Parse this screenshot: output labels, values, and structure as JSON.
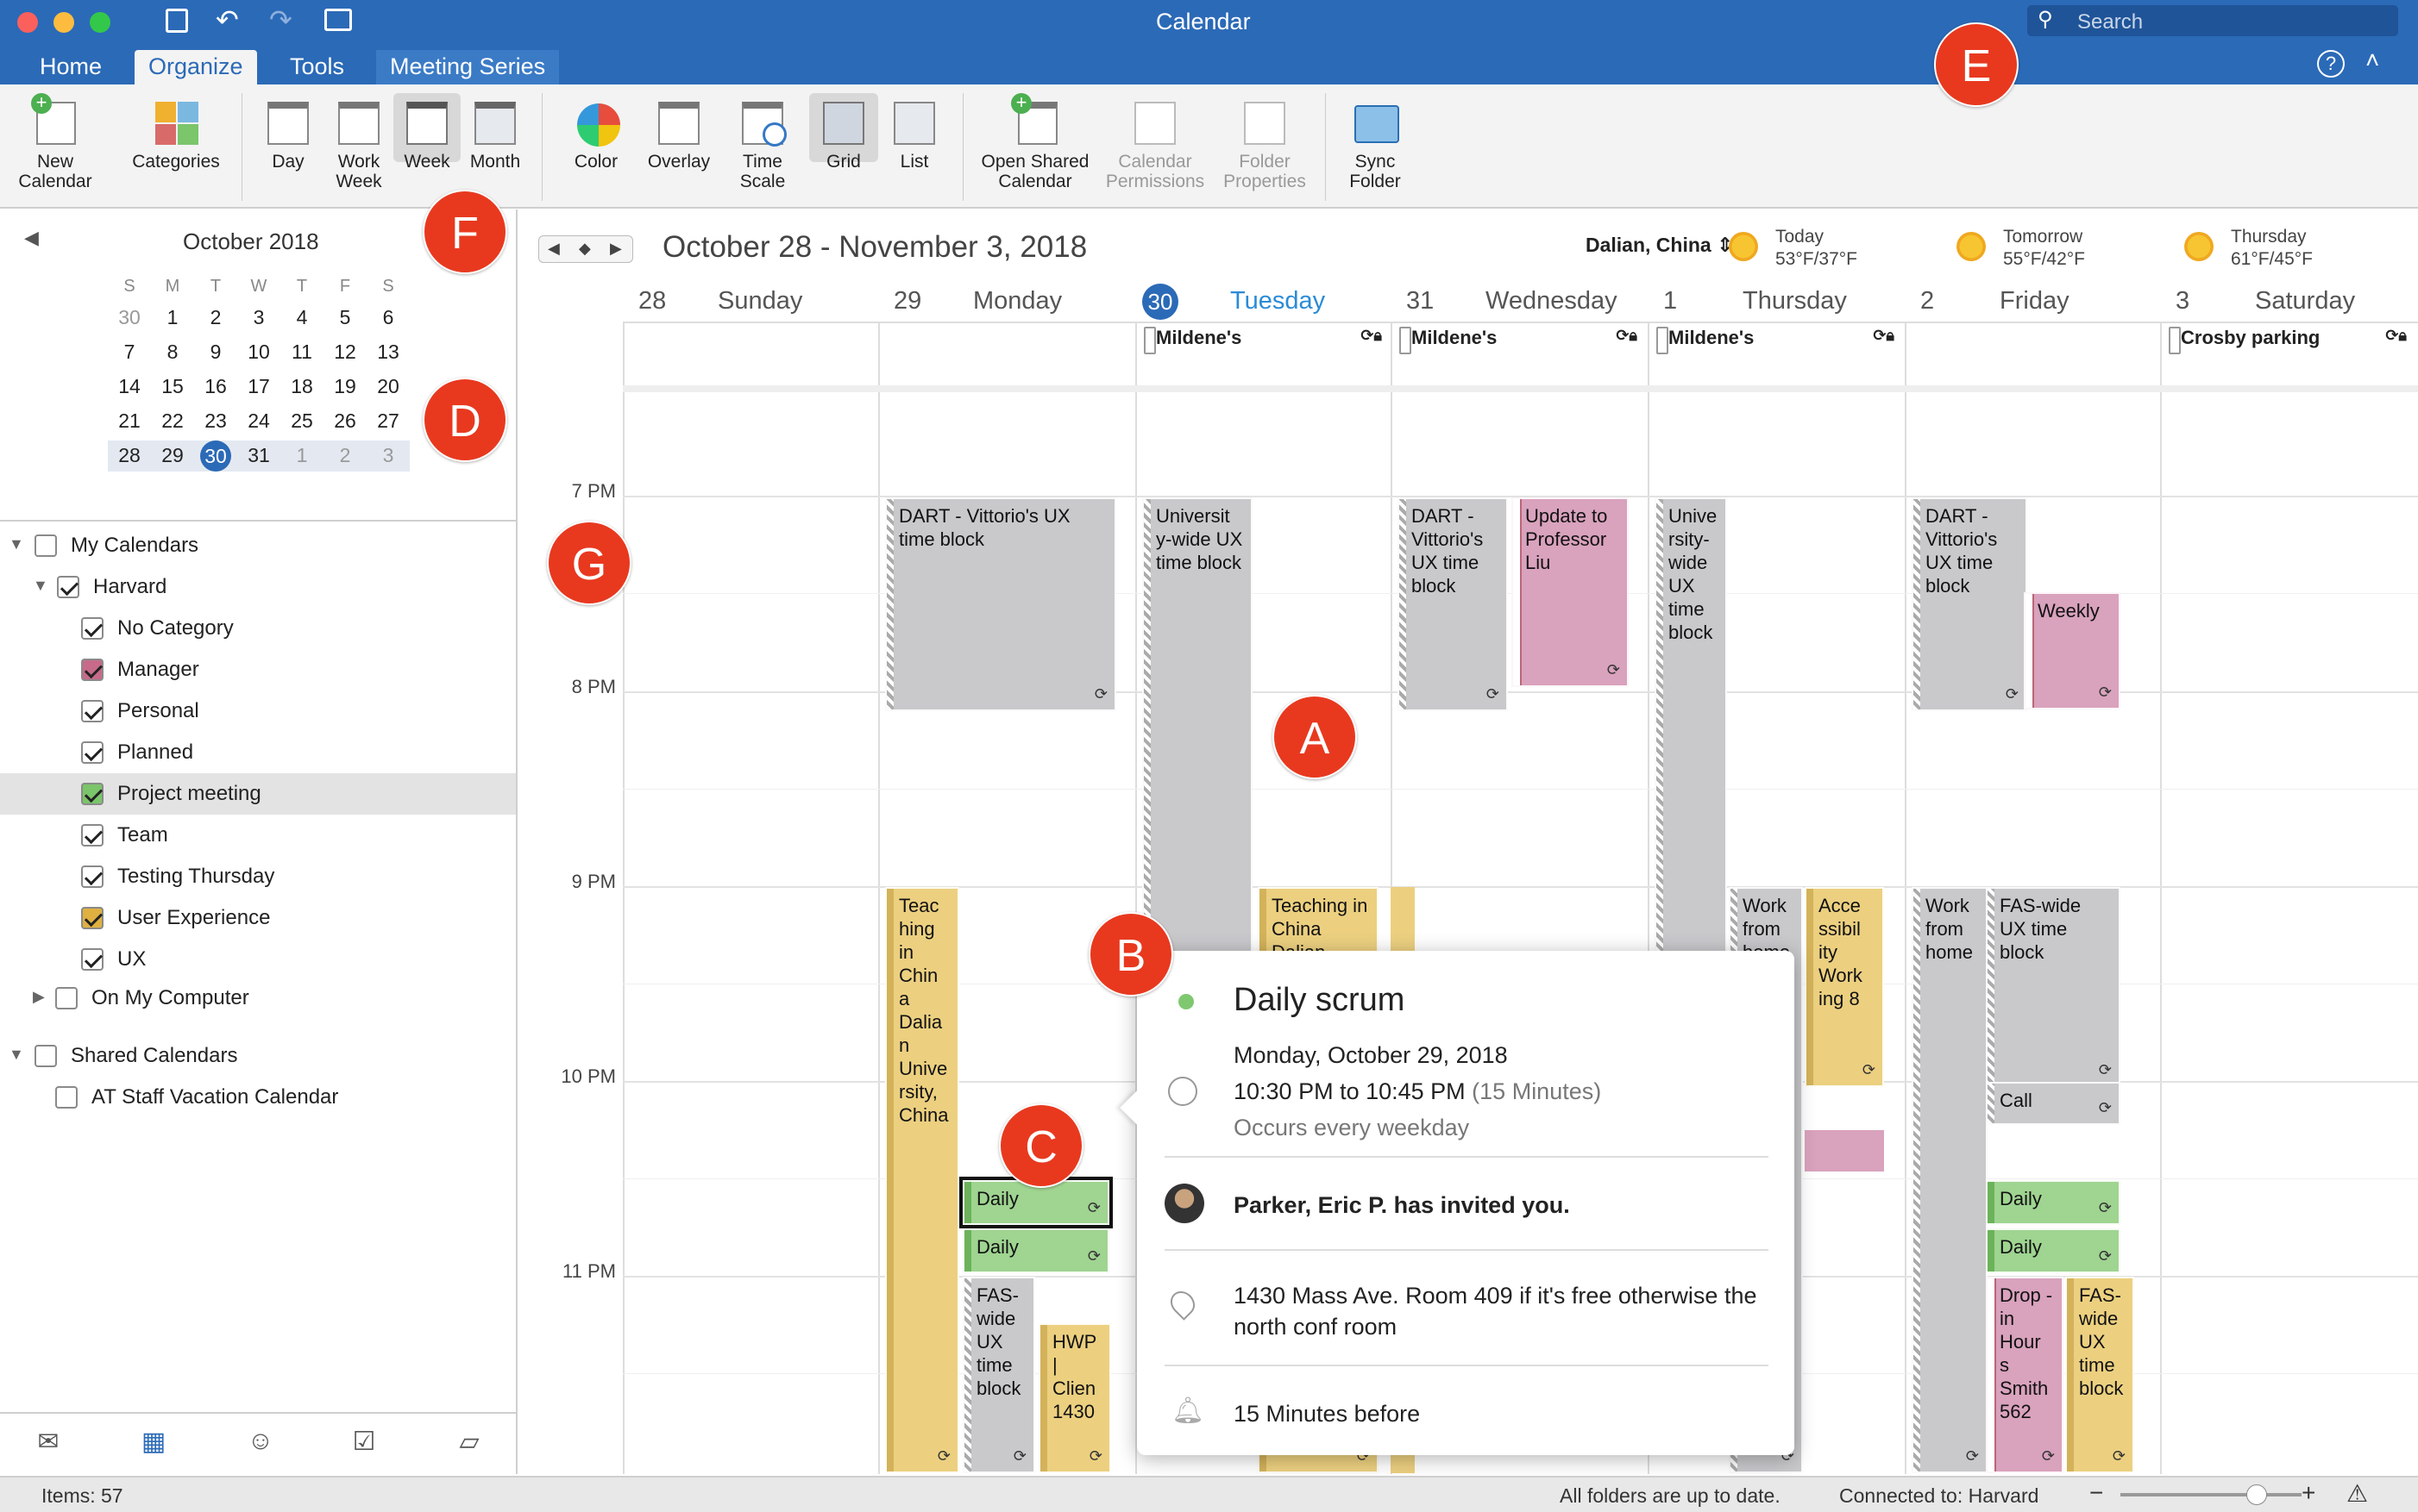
{
  "window": {
    "title": "Calendar",
    "search_placeholder": "Search"
  },
  "tabs": [
    "Home",
    "Organize",
    "Tools",
    "Meeting Series"
  ],
  "ribbon": {
    "new_calendar": "New Calendar",
    "categories": "Categories",
    "day": "Day",
    "work_week": "Work Week",
    "week": "Week",
    "month": "Month",
    "color": "Color",
    "overlay": "Overlay",
    "time_scale": "Time Scale",
    "grid": "Grid",
    "list": "List",
    "open_shared": "Open Shared Calendar",
    "calendar_permissions": "Calendar Permissions",
    "folder_properties": "Folder Properties",
    "sync_folder": "Sync Folder"
  },
  "mini_calendar": {
    "month": "October 2018",
    "weekdays": [
      "S",
      "M",
      "T",
      "W",
      "T",
      "F",
      "S"
    ],
    "weeks": [
      [
        "30",
        "1",
        "2",
        "3",
        "4",
        "5",
        "6"
      ],
      [
        "7",
        "8",
        "9",
        "10",
        "11",
        "12",
        "13"
      ],
      [
        "14",
        "15",
        "16",
        "17",
        "18",
        "19",
        "20"
      ],
      [
        "21",
        "22",
        "23",
        "24",
        "25",
        "26",
        "27"
      ],
      [
        "28",
        "29",
        "30",
        "31",
        "1",
        "2",
        "3"
      ]
    ],
    "today": "30"
  },
  "calendars": {
    "my": "My Calendars",
    "harvard": "Harvard",
    "items": [
      "No Category",
      "Manager",
      "Personal",
      "Planned",
      "Project meeting",
      "Team",
      "Testing Thursday",
      "User Experience",
      "UX"
    ],
    "on_my_computer": "On My Computer",
    "shared": "Shared Calendars",
    "at_staff": "AT Staff Vacation Calendar"
  },
  "main": {
    "range": "October 28 - November 3, 2018",
    "location": "Dalian, China",
    "weather": [
      {
        "label": "Today",
        "temp": "53°F/37°F"
      },
      {
        "label": "Tomorrow",
        "temp": "55°F/42°F"
      },
      {
        "label": "Thursday",
        "temp": "61°F/45°F"
      }
    ],
    "days": [
      {
        "num": "28",
        "name": "Sunday"
      },
      {
        "num": "29",
        "name": "Monday"
      },
      {
        "num": "30",
        "name": "Tuesday"
      },
      {
        "num": "31",
        "name": "Wednesday"
      },
      {
        "num": "1",
        "name": "Thursday"
      },
      {
        "num": "2",
        "name": "Friday"
      },
      {
        "num": "3",
        "name": "Saturday"
      }
    ],
    "allday": [
      "Mildene's",
      "Mildene's",
      "Mildene's",
      "Crosby parking"
    ],
    "times": [
      "7 PM",
      "8 PM",
      "9 PM",
      "10 PM",
      "11 PM"
    ],
    "events": {
      "dart_mon": "DART - Vittorio's UX time block",
      "univ_tue": "Universit y-wide UX time block",
      "dart_wed": "DART - Vittorio's UX time block",
      "update_wed": "Update to Professor Liu",
      "univ_thu": "Unive rsity-wide UX time block",
      "dart_fri": "DART - Vittorio's UX time block",
      "weekly_fri": "Weekly",
      "teach_mon": "Teac hing in Chin a Dalia n Unive rsity, China",
      "teach_tue": "Teaching in China Dalian",
      "wfh_thu": "Work from home",
      "access_thu": "Acce ssibil ity Work ing 8",
      "wfh_fri": "Work from home",
      "fas_fri": "FAS-wide UX time block",
      "call_fri": "Call",
      "daily1": "Daily",
      "daily2": "Daily",
      "daily_fri1": "Daily",
      "daily_fri2": "Daily",
      "fas_mon": "FAS-wide UX time block",
      "hwp_mon": "HWP | Clien 1430",
      "dropin_fri": "Drop -in Hour s Smith 562",
      "fas_fri2": "FAS-wide UX time block"
    }
  },
  "popup": {
    "title": "Daily scrum",
    "date": "Monday, October 29, 2018",
    "time": "10:30 PM to 10:45 PM",
    "duration": "(15 Minutes)",
    "recurrence": "Occurs every weekday",
    "invite": "Parker, Eric P. has invited you.",
    "location": "1430 Mass Ave. Room 409 if it's free otherwise the north conf room",
    "reminder": "15 Minutes before"
  },
  "markers": [
    "A",
    "B",
    "C",
    "D",
    "E",
    "F",
    "G"
  ],
  "status": {
    "items": "Items: 57",
    "folders": "All folders are up to date.",
    "connected": "Connected to: Harvard"
  }
}
